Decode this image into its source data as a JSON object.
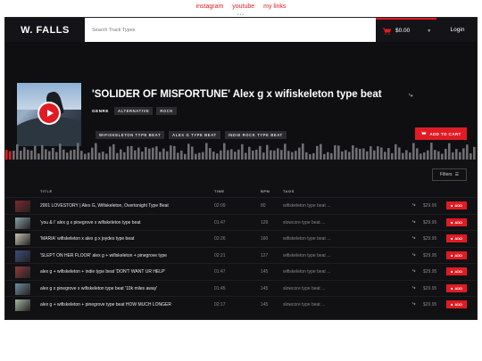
{
  "top_links": [
    "instagram",
    "youtube",
    "my links"
  ],
  "top_dots": "•••",
  "header": {
    "logo": "W. FALLS",
    "search_placeholder": "Search Track Types",
    "cart_total": "$0.00",
    "login": "Login"
  },
  "hero": {
    "title": "'SOLIDER OF MISFORTUNE' Alex g x wifiskeleton type beat",
    "genre_label": "GENRE",
    "genres": [
      "ALTERNATIVE",
      "ROCK"
    ],
    "tags": [
      "WIFISKELETON TYPE BEAT",
      "ALEX G TYPE BEAT",
      "INDIE ROCK TYPE BEAT"
    ],
    "add_to_cart": "ADD TO CART",
    "cover_icon": "play-icon"
  },
  "filters": {
    "label": "Filters"
  },
  "table": {
    "headers": {
      "title": "TITLE",
      "time": "TIME",
      "bpm": "BPM",
      "tags": "TAGS"
    },
    "add_label": "ADD",
    "rows": [
      {
        "title": "2001 LOVESTORY | Alex G, Wifiskeleton, Overtonight Type Beat",
        "time": "02:09",
        "bpm": "80",
        "tags": "wifiskeleton type beat ...",
        "price": "$29.95",
        "thumb": "#7a2a2a"
      },
      {
        "title": "'you & I' alex g x pinegrove x wifiskeleton type beat",
        "time": "01:47",
        "bpm": "129",
        "tags": "slowcore type beat ...",
        "price": "$29.95",
        "thumb": "#8aa0a8"
      },
      {
        "title": "'MARIA' wifiskeleton x alex g x joydes type beat",
        "time": "02:26",
        "bpm": "160",
        "tags": "wifiskeleton type beat ...",
        "price": "$29.95",
        "thumb": "#c9c1b0"
      },
      {
        "title": "'SLEPT ON HER FLOOR' alex g + wifiskeleton + pinegrove type",
        "time": "02:21",
        "bpm": "127",
        "tags": "wifiskeleton type beat ...",
        "price": "$29.95",
        "thumb": "#3a4e7a"
      },
      {
        "title": "alex g + wifiskeleton + indie type beat 'DON'T WANT UR HELP'",
        "time": "01:47",
        "bpm": "145",
        "tags": "wifiskeleton type beat ...",
        "price": "$29.95",
        "thumb": "#8b3a3a"
      },
      {
        "title": "alex g x pinegrove x wifiskeleton type beat '10k miles away'",
        "time": "01:45",
        "bpm": "145",
        "tags": "slowcore type beat ...",
        "price": "$29.95",
        "thumb": "#6f8c9c"
      },
      {
        "title": "alex g + wifiskeleton + pinegrove type beat HOW MUCH LONGER",
        "time": "02:17",
        "bpm": "145",
        "tags": "slowcore type beat ...",
        "price": "$29.95",
        "thumb": "#a6b5a0"
      }
    ]
  }
}
